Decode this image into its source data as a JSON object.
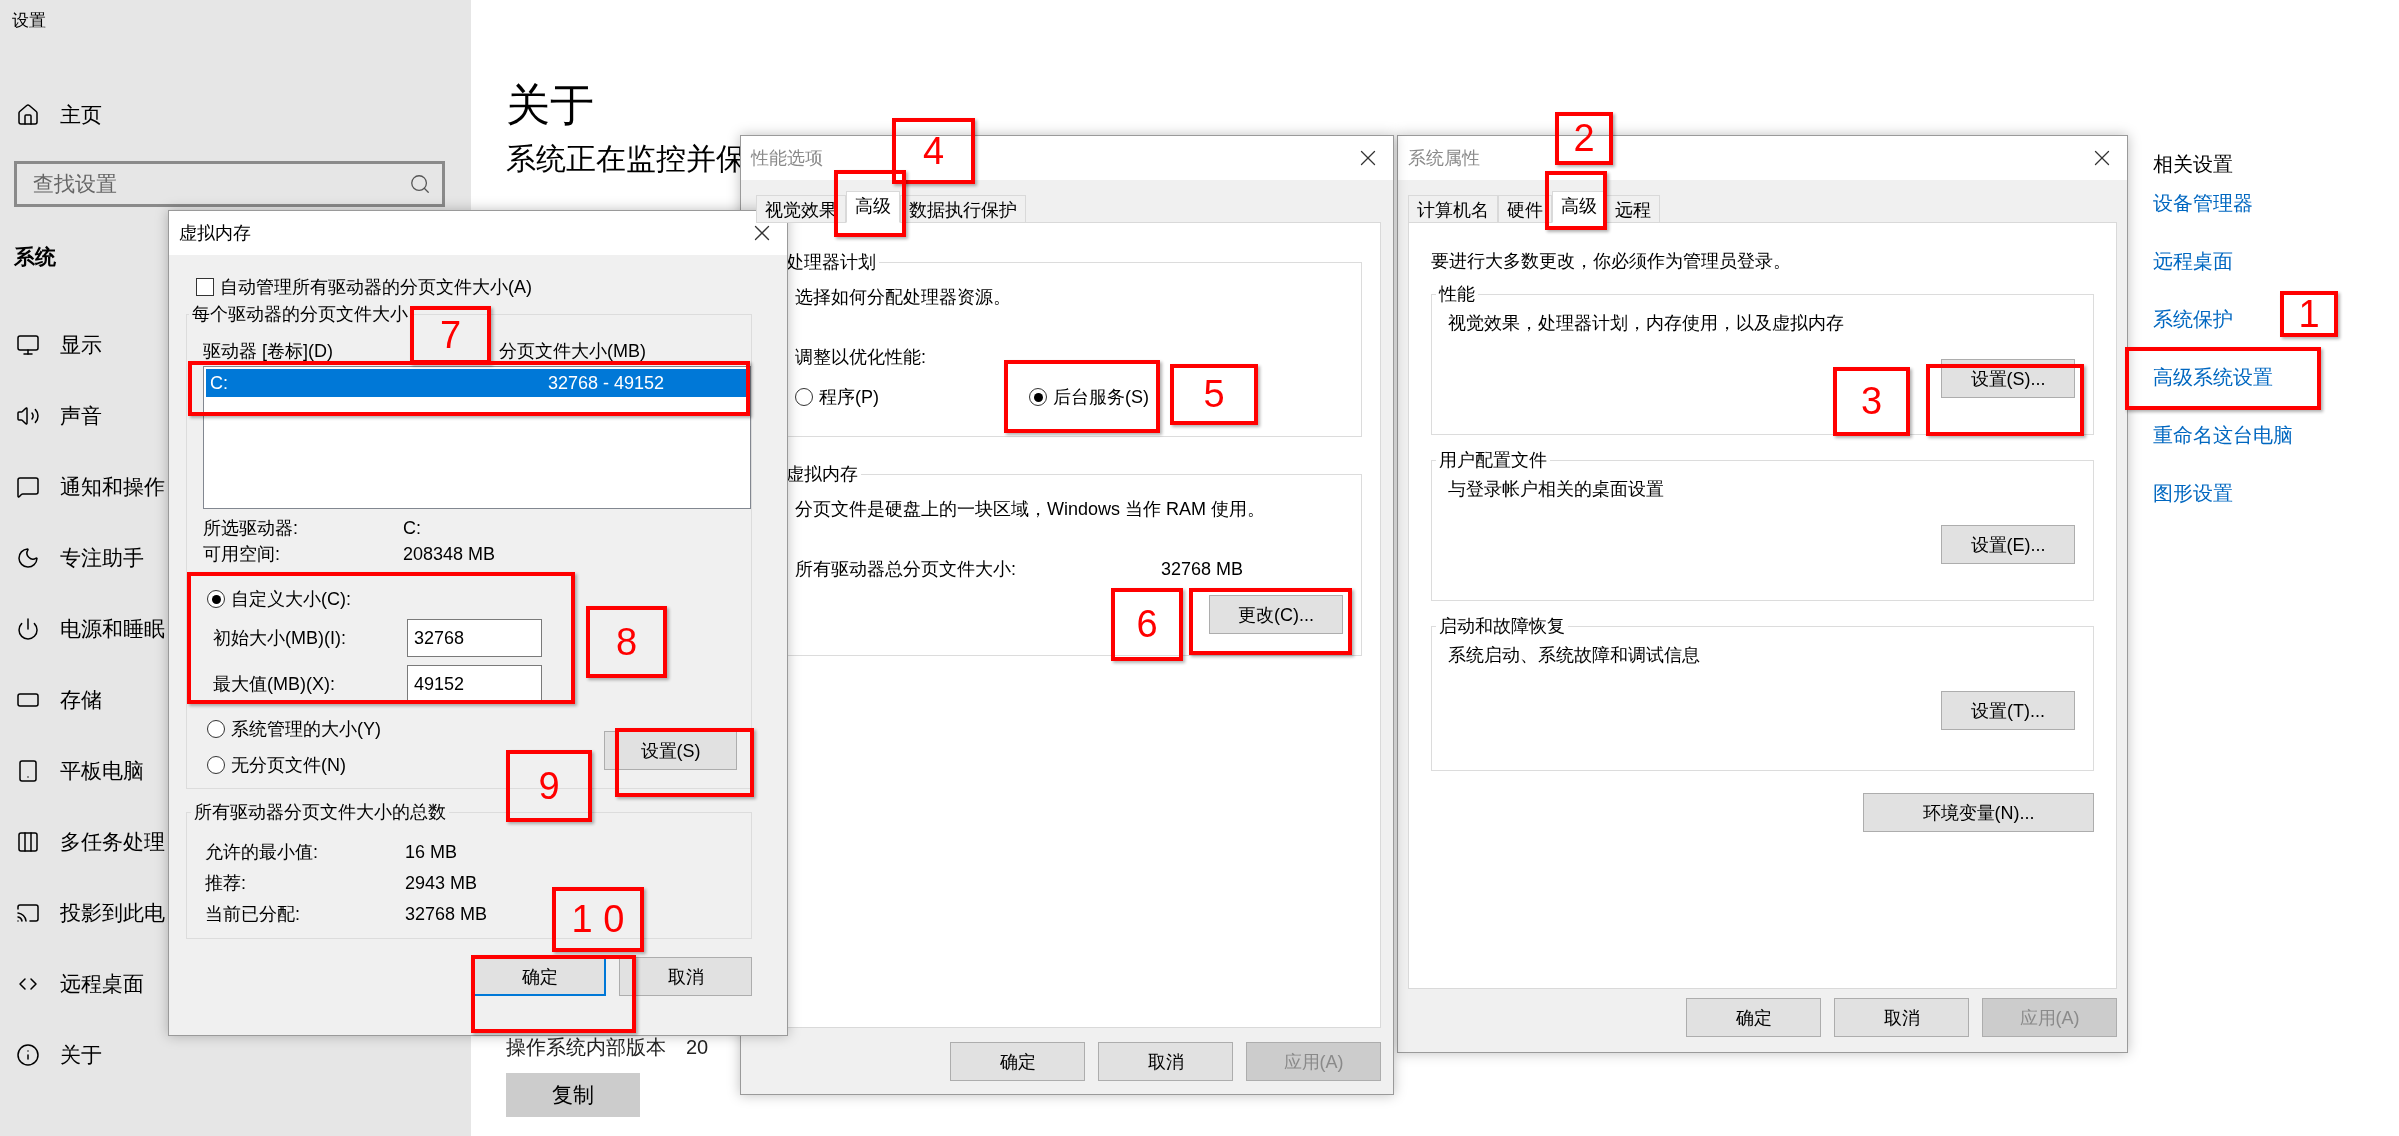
{
  "settings": {
    "title": "设置",
    "home": "主页",
    "search_placeholder": "查找设置",
    "section": "系统",
    "nav": [
      "显示",
      "声音",
      "通知和操作",
      "专注助手",
      "电源和睡眠",
      "存储",
      "平板电脑",
      "多任务处理",
      "投影到此电",
      "远程桌面",
      "关于"
    ],
    "page_title": "关于",
    "subtitle": "系统正在监控并保",
    "build_label": "操作系统内部版本",
    "build_value": "20",
    "copy_button": "复制"
  },
  "related": {
    "title": "相关设置",
    "links": [
      "设备管理器",
      "远程桌面",
      "系统保护",
      "高级系统设置",
      "重命名这台电脑",
      "图形设置"
    ]
  },
  "system_properties": {
    "title": "系统属性",
    "tabs": [
      {
        "label": "计算机名",
        "selected": false
      },
      {
        "label": "硬件",
        "selected": false
      },
      {
        "label": "高级",
        "selected": true
      },
      {
        "label": "远程",
        "selected": false
      }
    ],
    "notice": "要进行大多数更改，你必须作为管理员登录。",
    "groups": [
      {
        "title": "性能",
        "text": "视觉效果，处理器计划，内存使用，以及虚拟内存",
        "button": "设置(S)..."
      },
      {
        "title": "用户配置文件",
        "text": "与登录帐户相关的桌面设置",
        "button": "设置(E)..."
      },
      {
        "title": "启动和故障恢复",
        "text": "系统启动、系统故障和调试信息",
        "button": "设置(T)..."
      }
    ],
    "env_button": "环境变量(N)...",
    "buttons": [
      {
        "label": "确定",
        "disabled": false
      },
      {
        "label": "取消",
        "disabled": false
      },
      {
        "label": "应用(A)",
        "disabled": true
      }
    ]
  },
  "performance_options": {
    "title": "性能选项",
    "tabs": [
      {
        "label": "视觉效果",
        "selected": false
      },
      {
        "label": "高级",
        "selected": true
      },
      {
        "label": "数据执行保护",
        "selected": false
      }
    ],
    "cpu_group": "处理器计划",
    "cpu_text": "选择如何分配处理器资源。",
    "cpu_prompt": "调整以优化性能:",
    "cpu_options": [
      {
        "label": "程序(P)",
        "selected": false
      },
      {
        "label": "后台服务(S)",
        "selected": true
      }
    ],
    "vm_group": "虚拟内存",
    "vm_text": "分页文件是硬盘上的一块区域，Windows 当作 RAM 使用。",
    "vm_total_label": "所有驱动器总分页文件大小:",
    "vm_total_value": "32768 MB",
    "vm_button": "更改(C)...",
    "buttons": [
      {
        "label": "确定",
        "disabled": false
      },
      {
        "label": "取消",
        "disabled": false
      },
      {
        "label": "应用(A)",
        "disabled": true
      }
    ]
  },
  "virtual_memory": {
    "title": "虚拟内存",
    "auto_manage": {
      "label": "自动管理所有驱动器的分页文件大小(A)",
      "checked": false
    },
    "drives_group": "每个驱动器的分页文件大小",
    "columns": [
      "驱动器 [卷标](D)",
      "分页文件大小(MB)"
    ],
    "drives": [
      {
        "drive": "C:",
        "size": "32768 - 49152",
        "selected": true
      }
    ],
    "info": [
      {
        "label": "所选驱动器:",
        "value": "C:"
      },
      {
        "label": "可用空间:",
        "value": "208348 MB"
      }
    ],
    "size_options": [
      {
        "label": "自定义大小(C):",
        "selected": true
      },
      {
        "label": "系统管理的大小(Y)",
        "selected": false
      },
      {
        "label": "无分页文件(N)",
        "selected": false
      }
    ],
    "fields": [
      {
        "label": "初始大小(MB)(I):",
        "value": "32768"
      },
      {
        "label": "最大值(MB)(X):",
        "value": "49152"
      }
    ],
    "set_button": "设置(S)",
    "totals_group": "所有驱动器分页文件大小的总数",
    "totals": [
      {
        "label": "允许的最小值:",
        "value": "16 MB"
      },
      {
        "label": "推荐:",
        "value": "2943 MB"
      },
      {
        "label": "当前已分配:",
        "value": "32768 MB"
      }
    ],
    "buttons": [
      {
        "label": "确定",
        "default": true
      },
      {
        "label": "取消",
        "default": false
      }
    ]
  },
  "annotations": [
    {
      "kind": "number",
      "label": "1"
    },
    {
      "kind": "frame"
    },
    {
      "kind": "number",
      "label": "2"
    },
    {
      "kind": "frame"
    },
    {
      "kind": "number",
      "label": "3"
    },
    {
      "kind": "frame"
    },
    {
      "kind": "number",
      "label": "4"
    },
    {
      "kind": "frame"
    },
    {
      "kind": "frame"
    },
    {
      "kind": "number",
      "label": "5"
    },
    {
      "kind": "number",
      "label": "6"
    },
    {
      "kind": "frame"
    },
    {
      "kind": "number",
      "label": "7"
    },
    {
      "kind": "frame"
    },
    {
      "kind": "frame"
    },
    {
      "kind": "number",
      "label": "8"
    },
    {
      "kind": "frame"
    },
    {
      "kind": "number",
      "label": "9"
    },
    {
      "kind": "number",
      "label": "1 0"
    },
    {
      "kind": "frame"
    }
  ]
}
